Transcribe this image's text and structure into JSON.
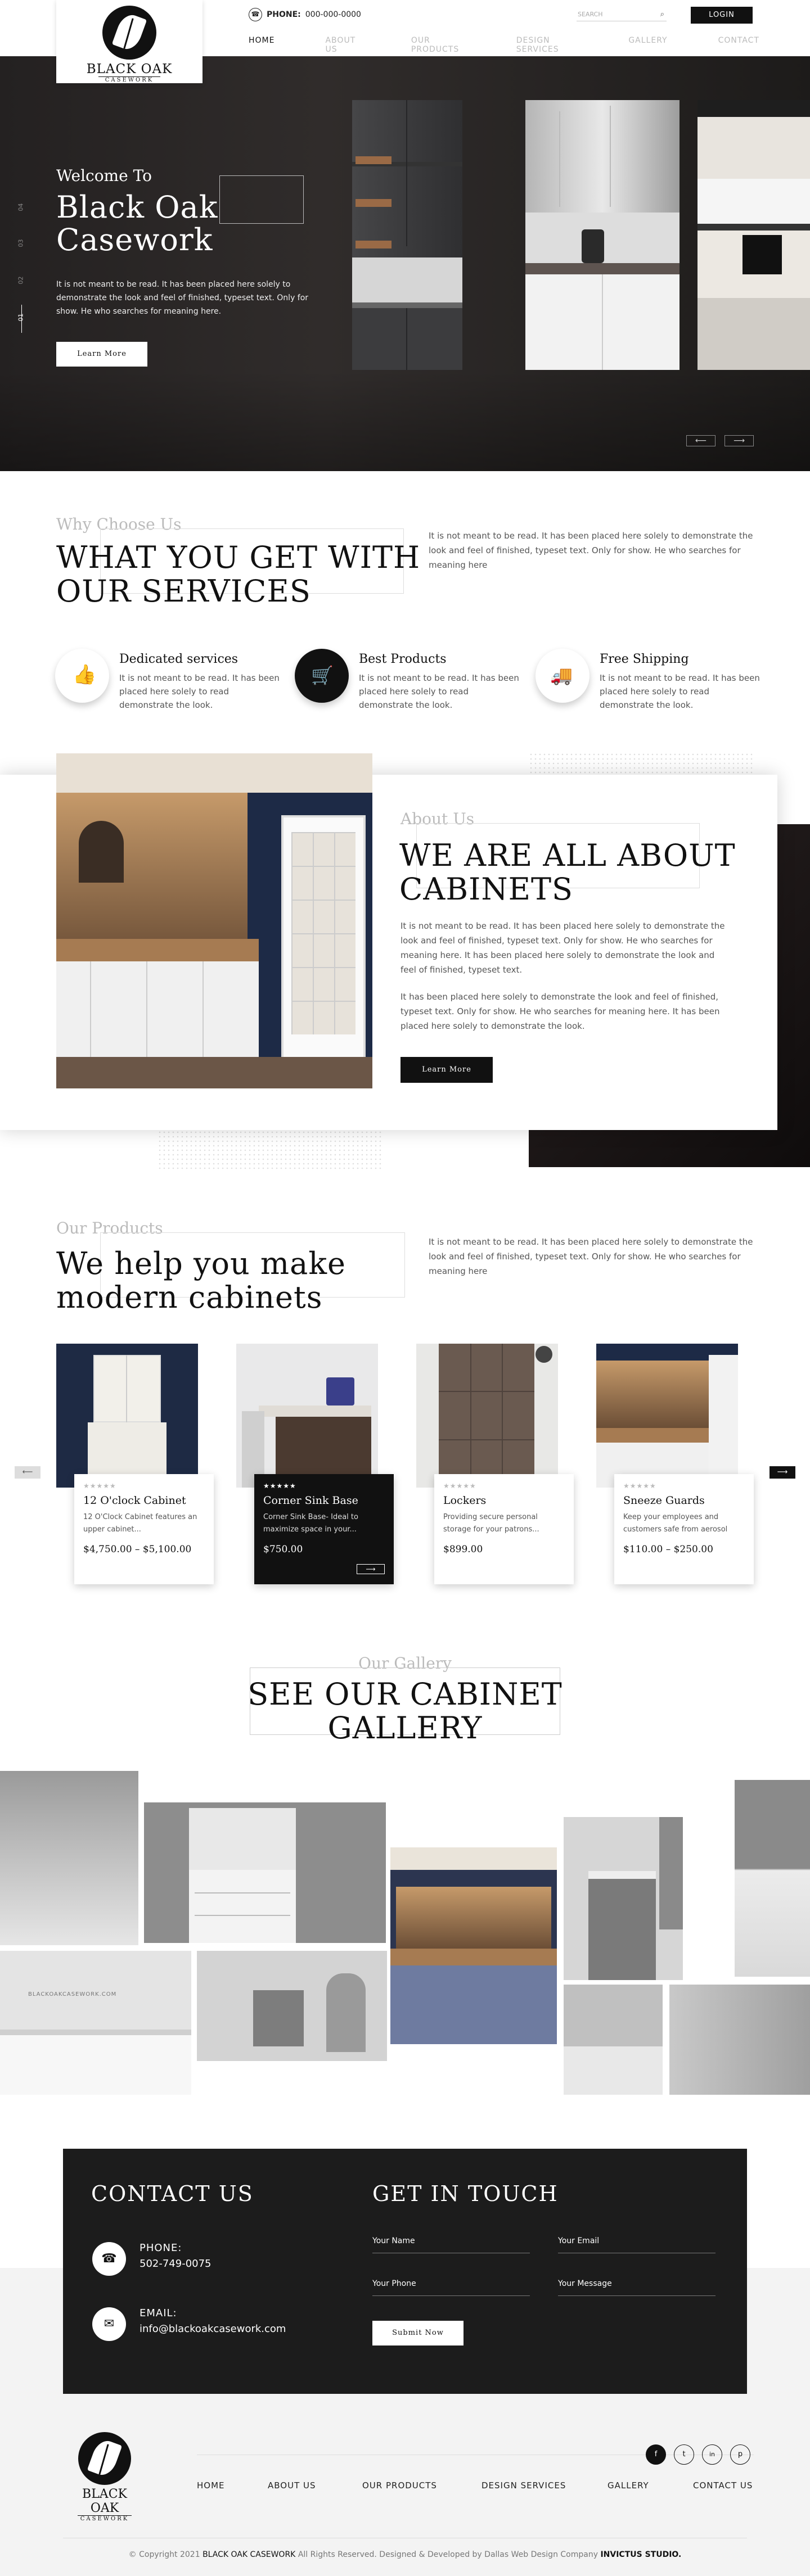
{
  "brand": {
    "name": "BLACK OAK",
    "sub": "CASEWORK"
  },
  "header": {
    "phone_label": "PHONE:",
    "phone": "000-000-0000",
    "search_placeholder": "SEARCH",
    "login": "LOGIN",
    "nav": [
      "HOME",
      "ABOUT US",
      "OUR PRODUCTS",
      "DESIGN SERVICES",
      "GALLERY",
      "CONTACT"
    ]
  },
  "hero": {
    "slides": [
      "04",
      "03",
      "02",
      "01"
    ],
    "welcome": "Welcome To",
    "title_line1": "Black Oak",
    "title_line2": "Casework",
    "desc": "It is not meant to be read. It has been placed here solely to demonstrate the look and feel of finished, typeset text. Only for show. He who searches for meaning here.",
    "button": "Learn More"
  },
  "why": {
    "sub": "Why Choose Us",
    "title_line1": "WHAT YOU GET WITH",
    "title_line2": "OUR SERVICES",
    "desc": "It is not meant to be read. It has been placed here solely to demonstrate the look and feel of finished, typeset text. Only for show. He who searches for meaning here",
    "features": [
      {
        "title": "Dedicated services",
        "desc": "It is not meant to be read. It has been placed here solely to read demonstrate the look.",
        "icon": "thumbs-up-icon"
      },
      {
        "title": "Best Products",
        "desc": "It is not meant to be read. It has been placed here solely to read demonstrate the look.",
        "icon": "cart-icon"
      },
      {
        "title": "Free Shipping",
        "desc": "It is not meant to be read. It has been placed here solely to read demonstrate the look.",
        "icon": "truck-icon"
      }
    ]
  },
  "about": {
    "sub": "About Us",
    "title_line1": "WE ARE ALL ABOUT",
    "title_line2": "CABINETS",
    "p1": "It is not meant to be read. It has been placed here solely to demonstrate the look and feel of finished, typeset text. Only for show. He who searches for meaning here. It has been placed here solely to demonstrate the look and feel of finished, typeset text.",
    "p2": "It has been placed here solely to demonstrate the look and feel of finished, typeset text. Only for show. He who searches for meaning here. It has been placed here solely to demonstrate the look.",
    "button": "Learn More"
  },
  "products": {
    "sub": "Our Products",
    "title_line1": "We help you make",
    "title_line2": "modern cabinets",
    "desc": "It is not meant to be read. It has been placed here solely to demonstrate the look and feel of finished, typeset text. Only for show. He who searches for meaning here",
    "items": [
      {
        "name": "12 O'clock Cabinet",
        "desc": "12 O'Clock Cabinet features an upper cabinet...",
        "price": "$4,750.00 – $5,100.00",
        "stars": "★★★★★"
      },
      {
        "name": "Corner Sink Base",
        "desc": "Corner Sink Base- Ideal to maximize space in your...",
        "price": "$750.00",
        "stars": "★★★★★"
      },
      {
        "name": "Lockers",
        "desc": "Providing secure personal storage for your patrons...",
        "price": "$899.00",
        "stars": "★★★★★"
      },
      {
        "name": "Sneeze Guards",
        "desc": "Keep your employees and customers safe from aerosol",
        "price": "$110.00 – $250.00",
        "stars": "★★★★★"
      }
    ]
  },
  "gallery": {
    "sub": "Our Gallery",
    "title_line1": "SEE OUR CABINET",
    "title_line2": "GALLERY",
    "watermark": "BLACKOAKCASEWORK.COM"
  },
  "contact": {
    "title": "CONTACT US",
    "phone_label": "PHONE:",
    "phone": "502-749-0075",
    "email_label": "EMAIL:",
    "email": "info@blackoakcasework.com",
    "form_title": "GET IN TOUCH",
    "name": "Your Name",
    "email_ph": "Your Email",
    "phone_ph": "Your Phone",
    "message": "Your Message",
    "submit": "Submit Now"
  },
  "footer": {
    "nav": [
      "HOME",
      "ABOUT US",
      "OUR PRODUCTS",
      "DESIGN SERVICES",
      "GALLERY",
      "CONTACT US"
    ],
    "social": [
      "f",
      "t",
      "in",
      "p"
    ],
    "copyright_pre": "© Copyright 2021",
    "copyright_brand": "BLACK OAK CASEWORK",
    "copyright_mid": "All Rights Reserved. Designed & Developed by Dallas Web Design Company",
    "copyright_studio": "INVICTUS STUDIO."
  }
}
